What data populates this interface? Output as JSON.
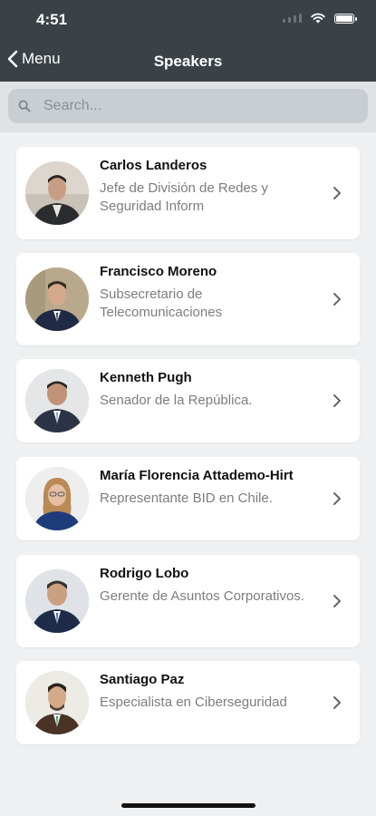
{
  "status": {
    "time": "4:51"
  },
  "nav": {
    "back_label": "Menu",
    "title": "Speakers"
  },
  "search": {
    "placeholder": "Search..."
  },
  "speakers": [
    {
      "name": "Carlos Landeros",
      "role": "Jefe de División de Redes y Seguridad Inform"
    },
    {
      "name": "Francisco Moreno",
      "role": "Subsecretario de Telecomunicaciones"
    },
    {
      "name": "Kenneth Pugh",
      "role": "Senador de la República."
    },
    {
      "name": "María Florencia Attademo-Hirt",
      "role": "Representante BID en Chile."
    },
    {
      "name": "Rodrigo Lobo",
      "role": "Gerente de Asuntos Corporativos."
    },
    {
      "name": "Santiago Paz",
      "role": "Especialista en Ciberseguridad"
    }
  ],
  "colors": {
    "header": "#3a4247",
    "background": "#eef0f1",
    "card": "#ffffff",
    "role_text": "#7d7d7d"
  },
  "icons": {
    "back": "chevron-left-icon",
    "search": "search-icon",
    "row": "chevron-right-icon"
  }
}
